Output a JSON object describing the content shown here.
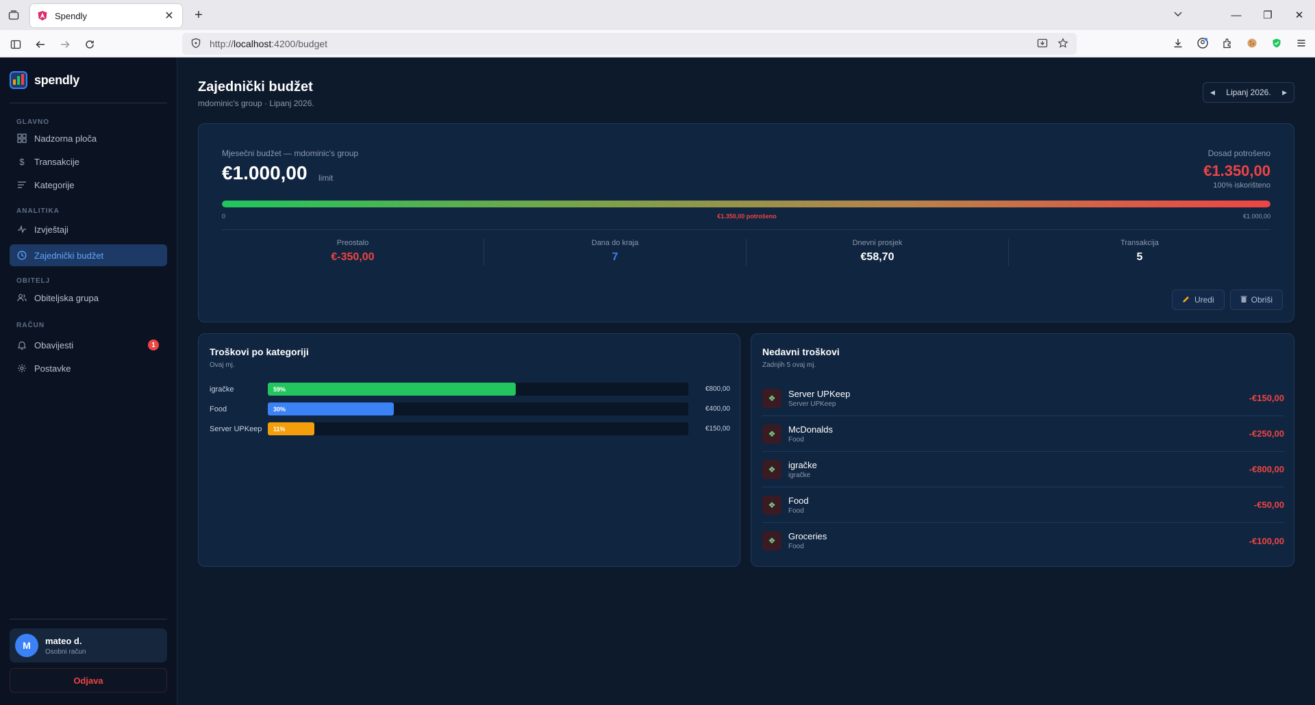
{
  "browser": {
    "tab_title": "Spendly",
    "url_prefix": "http://",
    "url_host": "localhost",
    "url_path": ":4200/budget"
  },
  "sidebar": {
    "brand": "spendly",
    "sections": {
      "main": "GLAVNO",
      "analytics": "ANALITIKA",
      "family": "OBITELJ",
      "account": "RAČUN"
    },
    "items": [
      {
        "label": "Nadzorna ploča",
        "icon": "grid-icon"
      },
      {
        "label": "Transakcije",
        "icon": "dollar-icon"
      },
      {
        "label": "Kategorije",
        "icon": "list-icon"
      },
      {
        "label": "Izvještaji",
        "icon": "activity-icon"
      },
      {
        "label": "Zajednički budžet",
        "icon": "clock-icon"
      },
      {
        "label": "Obiteljska grupa",
        "icon": "users-icon"
      },
      {
        "label": "Obavijesti",
        "icon": "bell-icon"
      },
      {
        "label": "Postavke",
        "icon": "gear-icon"
      }
    ],
    "notification_count": "1",
    "user": {
      "initial": "M",
      "name": "mateo d.",
      "subtitle": "Osobni račun"
    },
    "logout": "Odjava"
  },
  "header": {
    "title": "Zajednički budžet",
    "subtitle": "mdominic's group · Lipanj 2026.",
    "month": "Lipanj 2026."
  },
  "budget": {
    "label": "Mjesečni budžet — mdominic's group",
    "amount": "€1.000,00",
    "limit_word": "limit",
    "spent_label": "Dosad potrošeno",
    "spent": "€1.350,00",
    "used": "100% iskorišteno",
    "progress_fraction": 1.0,
    "bar_min": "0",
    "bar_spent": "€1.350,00 potrošeno",
    "bar_max": "€1.000,00",
    "stats": [
      {
        "label": "Preostalo",
        "value": "€-350,00",
        "color": "#ef4444"
      },
      {
        "label": "Dana do kraja",
        "value": "7",
        "color": "#3b82f6"
      },
      {
        "label": "Dnevni prosjek",
        "value": "€58,70",
        "color": "#ffffff"
      },
      {
        "label": "Transakcija",
        "value": "5",
        "color": "#ffffff"
      }
    ],
    "edit": "Uredi",
    "delete": "Obriši"
  },
  "categories": {
    "title": "Troškovi po kategoriji",
    "subtitle": "Ovaj mj.",
    "rows": [
      {
        "name": "igračke",
        "percent_label": "59%",
        "fraction": 0.59,
        "amount": "€800,00",
        "color": "#22c55e"
      },
      {
        "name": "Food",
        "percent_label": "30%",
        "fraction": 0.3,
        "amount": "€400,00",
        "color": "#3b82f6"
      },
      {
        "name": "Server UPKeep",
        "percent_label": "11%",
        "fraction": 0.11,
        "amount": "€150,00",
        "color": "#f59e0b"
      }
    ]
  },
  "recent": {
    "title": "Nedavni troškovi",
    "subtitle": "Zadnjih 5 ovaj mj.",
    "items": [
      {
        "name": "Server UPKeep",
        "category": "Server UPKeep",
        "amount": "-€150,00"
      },
      {
        "name": "McDonalds",
        "category": "Food",
        "amount": "-€250,00"
      },
      {
        "name": "igračke",
        "category": "igračke",
        "amount": "-€800,00"
      },
      {
        "name": "Food",
        "category": "Food",
        "amount": "-€50,00"
      },
      {
        "name": "Groceries",
        "category": "Food",
        "amount": "-€100,00"
      }
    ]
  }
}
